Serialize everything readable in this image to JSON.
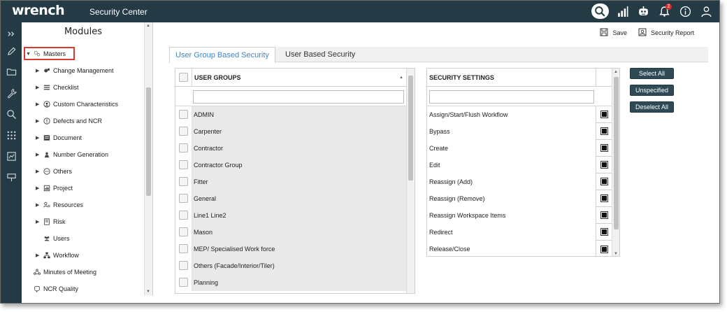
{
  "app": {
    "brand": "wrench",
    "title": "Security Center"
  },
  "topbar": {
    "notification_count": "2"
  },
  "modules": {
    "title": "Modules",
    "items": [
      {
        "label": "Masters",
        "icon": "masters-icon",
        "expanded": true
      },
      {
        "label": "Change Management",
        "icon": "gears-icon"
      },
      {
        "label": "Checklist",
        "icon": "checklist-icon"
      },
      {
        "label": "Custom Characteristics",
        "icon": "custom-char-icon"
      },
      {
        "label": "Defects and NCR",
        "icon": "info-circle-icon"
      },
      {
        "label": "Document",
        "icon": "document-icon"
      },
      {
        "label": "Number Generation",
        "icon": "number-gen-icon"
      },
      {
        "label": "Others",
        "icon": "ellipsis-circle-icon"
      },
      {
        "label": "Project",
        "icon": "project-icon"
      },
      {
        "label": "Resources",
        "icon": "resources-icon"
      },
      {
        "label": "Risk",
        "icon": "risk-icon"
      },
      {
        "label": "Users",
        "icon": "users-icon"
      },
      {
        "label": "Workflow",
        "icon": "workflow-icon"
      },
      {
        "label": "Minutes of Meeting",
        "icon": "meeting-icon"
      },
      {
        "label": "NCR Quality",
        "icon": "ncr-quality-icon"
      }
    ]
  },
  "toolbar": {
    "save_label": "Save",
    "report_label": "Security Report"
  },
  "tabs": [
    {
      "label": "User Group Based Security",
      "active": true
    },
    {
      "label": "User Based Security",
      "active": false
    }
  ],
  "user_groups": {
    "header": "USER GROUPS",
    "rows": [
      "ADMIN",
      "Carpenter",
      "Contractor",
      "Contractor Group",
      "Fitter",
      "General",
      "Line1 Line2",
      "Mason",
      "MEP/ Specialised Work force",
      "Others (Facade/Interior/Tiler)",
      "Planning"
    ]
  },
  "security_settings": {
    "header": "SECURITY SETTINGS",
    "rows": [
      "Assign/Start/Flush Workflow",
      "Bypass",
      "Create",
      "Edit",
      "Reassign (Add)",
      "Reassign (Remove)",
      "Reassign Workspace Items",
      "Redirect",
      "Release/Close"
    ]
  },
  "buttons": {
    "select_all": "Select All",
    "unspecified": "Unspecified",
    "deselect_all": "Deselect All"
  },
  "colors": {
    "topbar": "#243a45",
    "accent_tab": "#3e86c6",
    "button": "#2e4a57",
    "highlight": "#d93b2f"
  }
}
